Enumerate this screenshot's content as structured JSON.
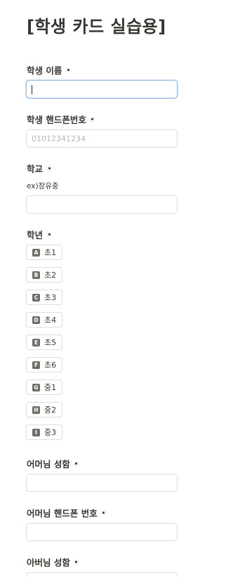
{
  "form": {
    "title": "[학생 카드 실습용]",
    "fields": {
      "student_name": {
        "label": "학생 이름",
        "value": ""
      },
      "student_phone": {
        "label": "학생 핸드폰번호",
        "placeholder": "01012341234"
      },
      "school": {
        "label": "학교",
        "hint": "ex)장유중",
        "value": ""
      },
      "grade": {
        "label": "학년",
        "options": [
          {
            "key": "A",
            "label": "초1"
          },
          {
            "key": "B",
            "label": "초2"
          },
          {
            "key": "C",
            "label": "초3"
          },
          {
            "key": "D",
            "label": "초4"
          },
          {
            "key": "E",
            "label": "초5"
          },
          {
            "key": "F",
            "label": "초6"
          },
          {
            "key": "G",
            "label": "중1"
          },
          {
            "key": "H",
            "label": "중2"
          },
          {
            "key": "I",
            "label": "중3"
          }
        ]
      },
      "mother_name": {
        "label": "어머님 성함",
        "value": ""
      },
      "mother_phone": {
        "label": "어머님 핸드폰 번호",
        "value": ""
      },
      "father_name": {
        "label": "아버님 성함",
        "value": ""
      }
    }
  },
  "colors": {
    "text": "#37352f",
    "border": "#dcdcd9",
    "focus_border": "#9fc3e8",
    "placeholder": "#b8b6b1",
    "key_badge": "#6f6e69"
  }
}
